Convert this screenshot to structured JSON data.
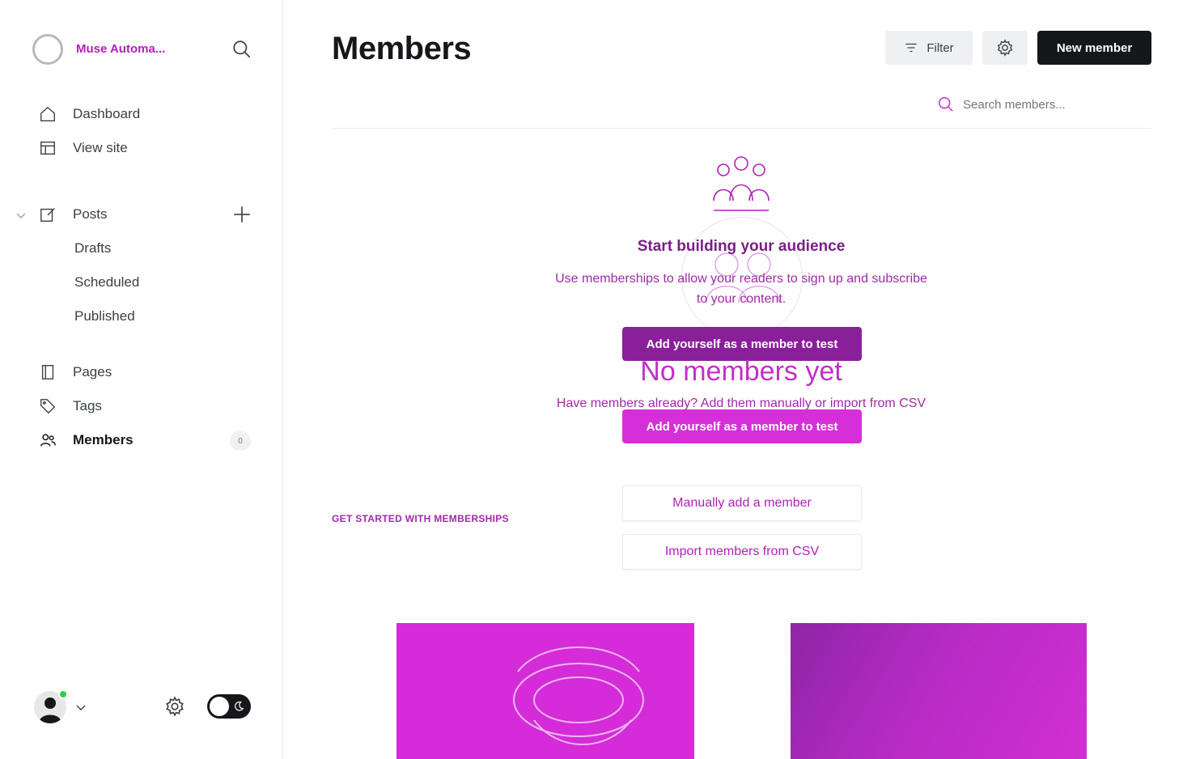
{
  "sidebar": {
    "brand_name": "Muse Automa...",
    "nav": [
      {
        "label": "Dashboard",
        "icon": "home-icon"
      },
      {
        "label": "View site",
        "icon": "layout-icon"
      },
      {
        "label": "Posts",
        "icon": "edit-icon"
      },
      {
        "label": "Drafts"
      },
      {
        "label": "Scheduled"
      },
      {
        "label": "Published"
      },
      {
        "label": "Pages",
        "icon": "page-icon"
      },
      {
        "label": "Tags",
        "icon": "tag-icon"
      },
      {
        "label": "Members",
        "icon": "members-icon",
        "active": true,
        "count": "0"
      }
    ]
  },
  "header": {
    "title": "Members",
    "filter_label": "Filter",
    "new_member_label": "New member",
    "search_placeholder": "Search members..."
  },
  "empty_state": {
    "title": "Start building your audience",
    "description": "Use memberships to allow your readers to sign up and subscribe to your content.",
    "add_self_label": "Add yourself as a member to test",
    "no_members": "No members yet",
    "have_members": "Have members already? Add them manually or import from CSV",
    "add_self_label_2": "Add yourself as a member to test"
  },
  "get_started": {
    "heading": "GET STARTED WITH MEMBERSHIPS",
    "manual_label": "Manually add a member",
    "import_label": "Import members from CSV"
  },
  "colors": {
    "accent": "#b221b8",
    "primary_button": "#15171a",
    "online_dot": "#30cf43"
  }
}
